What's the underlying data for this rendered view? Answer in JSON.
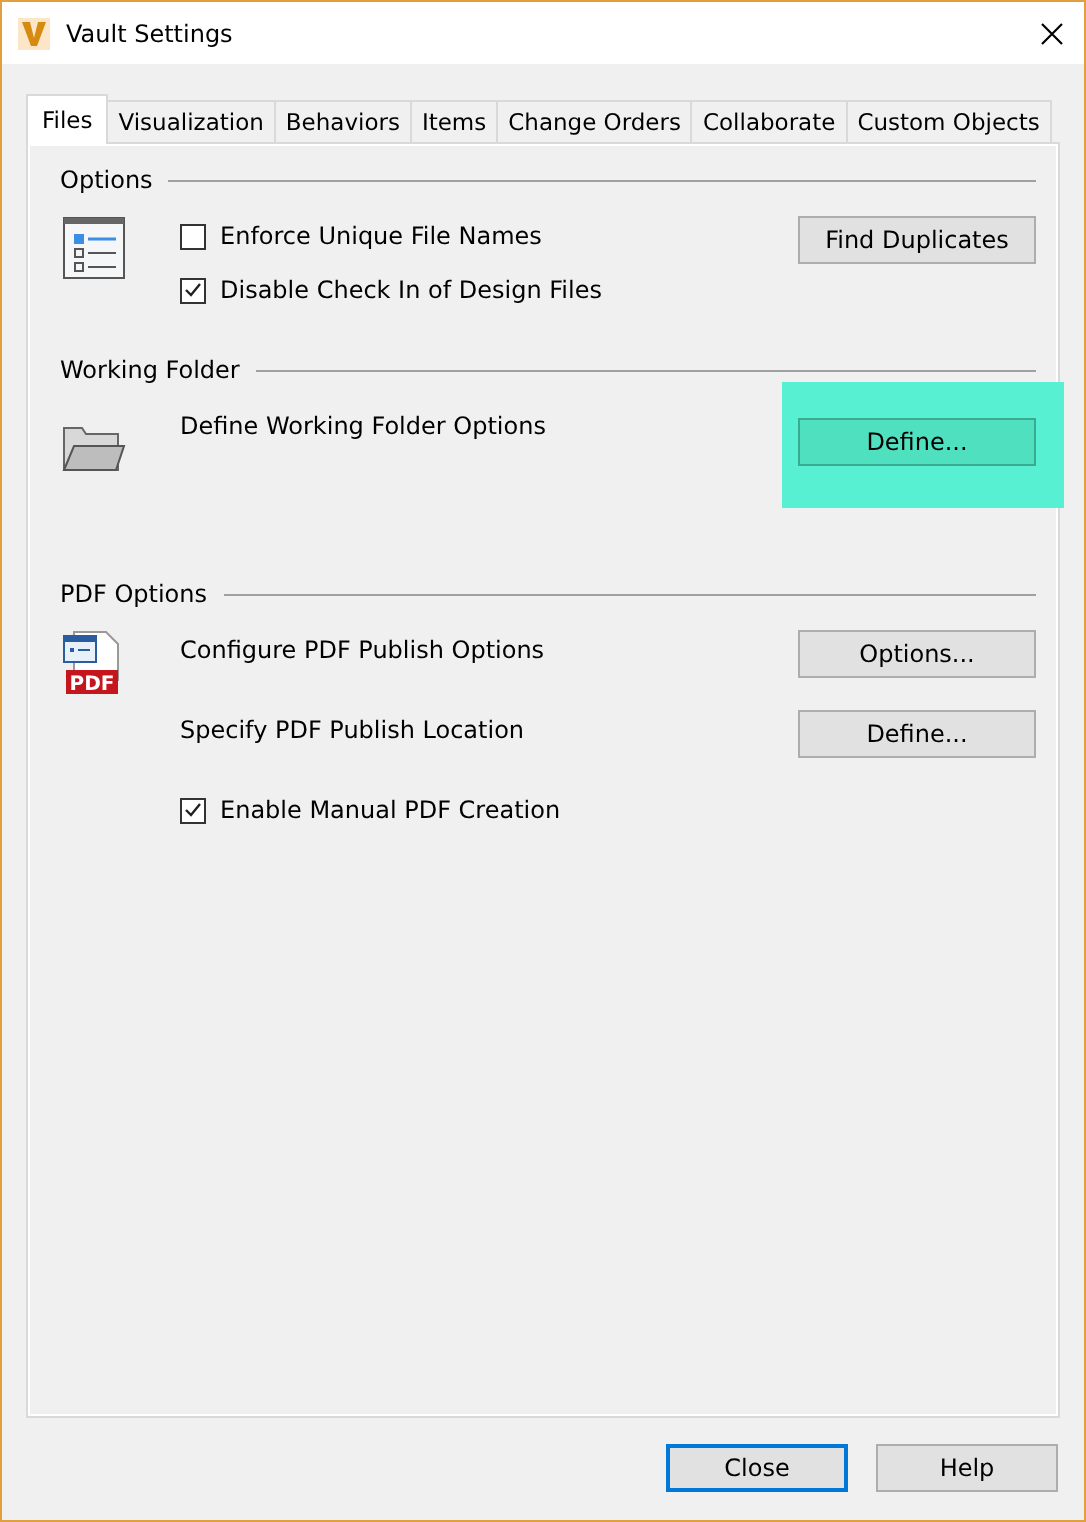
{
  "window": {
    "title": "Vault Settings"
  },
  "tabs": [
    {
      "label": "Files",
      "selected": true
    },
    {
      "label": "Visualization",
      "selected": false
    },
    {
      "label": "Behaviors",
      "selected": false
    },
    {
      "label": "Items",
      "selected": false
    },
    {
      "label": "Change Orders",
      "selected": false
    },
    {
      "label": "Collaborate",
      "selected": false
    },
    {
      "label": "Custom Objects",
      "selected": false
    }
  ],
  "sections": [
    {
      "title": "Options",
      "icon": {
        "kind": "list"
      },
      "rows": [
        {
          "kind": "checkbox",
          "label": "Enforce Unique File Names",
          "checked": false,
          "button": {
            "label": "Find Duplicates",
            "highlighted": false
          }
        },
        {
          "kind": "checkbox",
          "label": "Disable Check In of Design Files",
          "checked": true
        }
      ]
    },
    {
      "title": "Working Folder",
      "icon": {
        "kind": "folder"
      },
      "rows": [
        {
          "kind": "text",
          "label": "Define Working Folder Options",
          "button": {
            "label": "Define...",
            "highlighted": true
          }
        }
      ]
    },
    {
      "title": "PDF Options",
      "icon": {
        "kind": "pdf",
        "text": "PDF"
      },
      "rows": [
        {
          "kind": "text",
          "label": "Configure PDF Publish Options",
          "button": {
            "label": "Options...",
            "highlighted": false
          }
        },
        {
          "kind": "text",
          "label": "Specify PDF Publish Location",
          "button": {
            "label": "Define...",
            "highlighted": false
          }
        },
        {
          "kind": "checkbox",
          "label": "Enable Manual PDF Creation",
          "checked": true
        }
      ]
    }
  ],
  "buttons": [
    {
      "label": "Close",
      "default": true
    },
    {
      "label": "Help",
      "default": false
    }
  ]
}
